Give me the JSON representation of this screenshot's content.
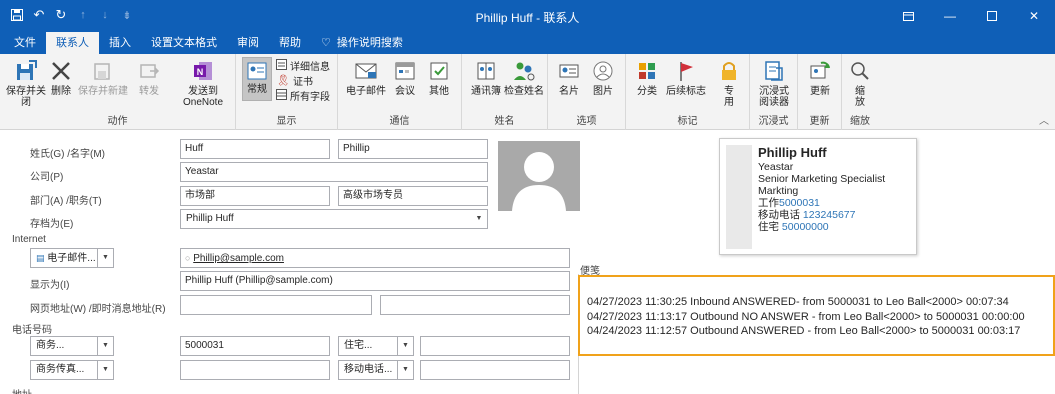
{
  "titlebar": {
    "title": "Phillip Huff  -  联系人",
    "qat": [
      "save-icon",
      "undo-icon",
      "redo-icon",
      "up-icon",
      "down-icon",
      "customize-icon"
    ]
  },
  "tabs": [
    "文件",
    "联系人",
    "插入",
    "设置文本格式",
    "审阅",
    "帮助",
    "操作说明搜索"
  ],
  "ribbon": {
    "groups": {
      "actions": {
        "label": "动作",
        "save_close": "保存并关闭",
        "delete": "删除",
        "save_new": "保存并新建",
        "forward": "转发",
        "onenote_1": "发送到",
        "onenote_2": "OneNote"
      },
      "show": {
        "label": "显示",
        "general": "常规",
        "details": "详细信息",
        "certificates": "证书",
        "all_fields": "所有字段"
      },
      "communicate": {
        "label": "通信",
        "email": "电子邮件",
        "meeting": "会议",
        "more": "其他"
      },
      "names": {
        "label": "姓名",
        "address_book": "通讯簿",
        "check_names": "检查姓名"
      },
      "options": {
        "label": "选项",
        "business_card": "名片",
        "picture": "图片"
      },
      "tags": {
        "label": "标记",
        "categorize": "分类",
        "follow_up": "后续标志",
        "private": "专用"
      },
      "immersive": {
        "label": "沉浸式",
        "reader": "沉浸式阅读器"
      },
      "update": {
        "label": "更新",
        "update": "更新"
      },
      "zoom": {
        "label": "缩放",
        "zoom": "缩放"
      }
    }
  },
  "form": {
    "name_label": "姓氏(G)  /名字(M)",
    "last_name": "Huff",
    "first_name": "Phillip",
    "company_label": "公司(P)",
    "company": "Yeastar",
    "dept_label": "部门(A)  /职务(T)",
    "department": "市场部",
    "job_title": "高级市场专员",
    "file_as_label": "存档为(E)",
    "file_as": "Phillip Huff",
    "internet_label": "Internet",
    "email_type": "电子邮件...",
    "email": "Phillip@sample.com",
    "display_as_label": "显示为(I)",
    "display_as": "Phillip Huff (Phillip@sample.com)",
    "web_label": "网页地址(W)  /即时消息地址(R)",
    "web": "",
    "im": "",
    "phone_label": "电话号码",
    "phone1_type": "商务...",
    "phone1": "5000031",
    "phone2_type": "住宅...",
    "phone2": "",
    "phone3_type": "商务传真...",
    "phone3": "",
    "phone4_type": "移动电话...",
    "phone4": "",
    "address_label": "地址"
  },
  "card": {
    "name": "Phillip Huff",
    "company": "Yeastar",
    "title": "Senior Marketing Specialist",
    "department": "Markting",
    "work_label": "工作",
    "work": "5000031",
    "mobile_label": "移动电话",
    "mobile": "123245677",
    "home_label": "住宅",
    "home": "50000000"
  },
  "notes": {
    "label": "便笺",
    "lines": [
      "04/27/2023 11:30:25 Inbound ANSWERED- from 5000031 to  Leo Ball<2000> 00:07:34",
      "04/27/2023 11:13:17 Outbound NO ANSWER - from  Leo Ball<2000> to 5000031 00:00:00",
      "04/24/2023 11:12:57 Outbound ANSWERED - from  Leo Ball<2000> to 5000031 00:03:17"
    ]
  },
  "colors": {
    "accent": "#0f5fb7",
    "highlight_border": "#f0a21a",
    "link": "#2e75b6"
  }
}
